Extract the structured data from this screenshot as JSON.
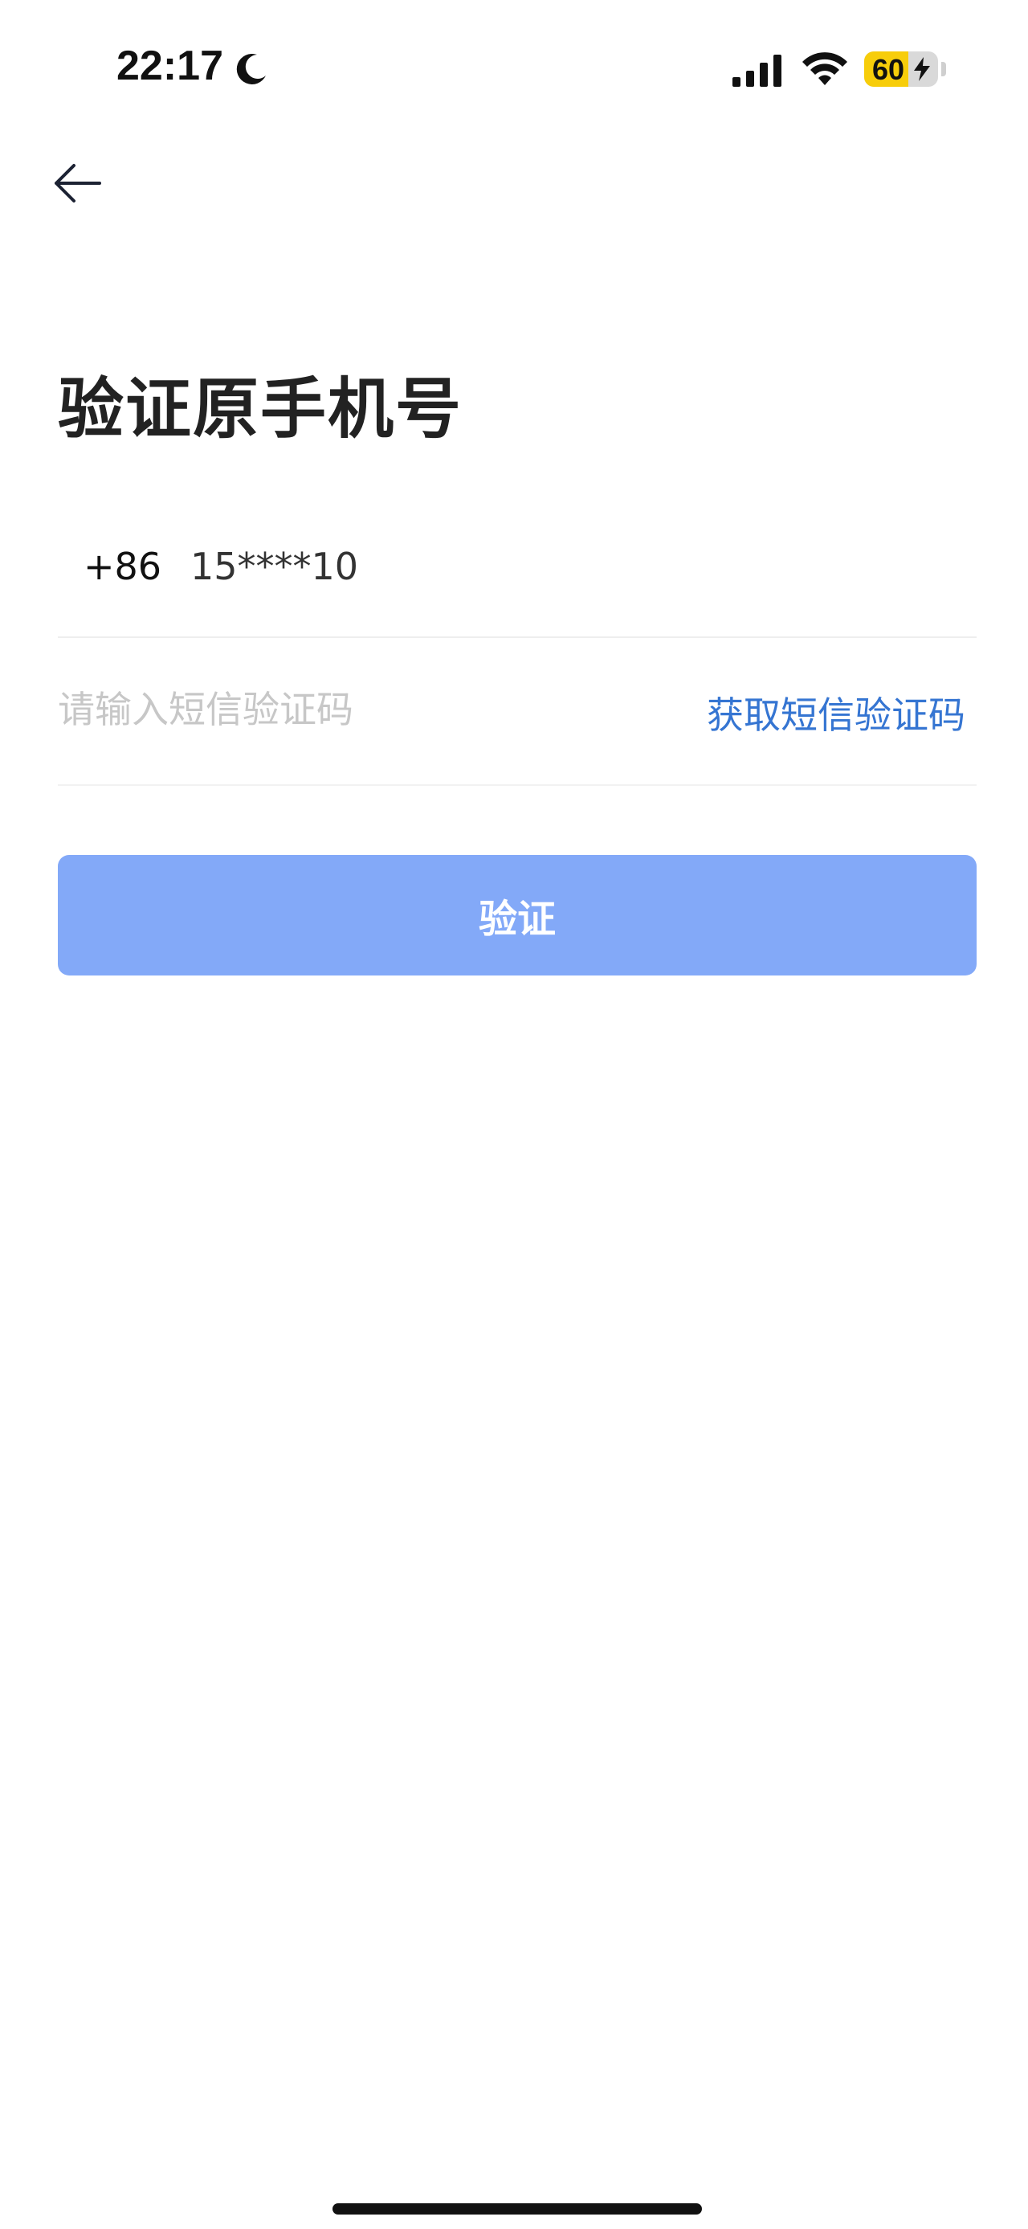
{
  "status_bar": {
    "time": "22:17",
    "battery_percent": "60",
    "battery_level": 0.6,
    "icons": [
      "moon-icon",
      "signal-icon",
      "wifi-icon",
      "battery-icon",
      "charging-bolt-icon"
    ]
  },
  "nav": {
    "back_icon": "arrow-left-icon"
  },
  "page": {
    "title": "验证原手机号"
  },
  "phone": {
    "country_code": "+86",
    "masked_number": "15****10"
  },
  "sms": {
    "placeholder": "请输入短信验证码",
    "value": "",
    "get_code_label": "获取短信验证码"
  },
  "actions": {
    "verify_label": "验证"
  },
  "colors": {
    "accent": "#3575d2",
    "button_disabled": "#83a9f8",
    "battery_yellow": "#f7cd0a",
    "placeholder": "#c7c7c7"
  }
}
